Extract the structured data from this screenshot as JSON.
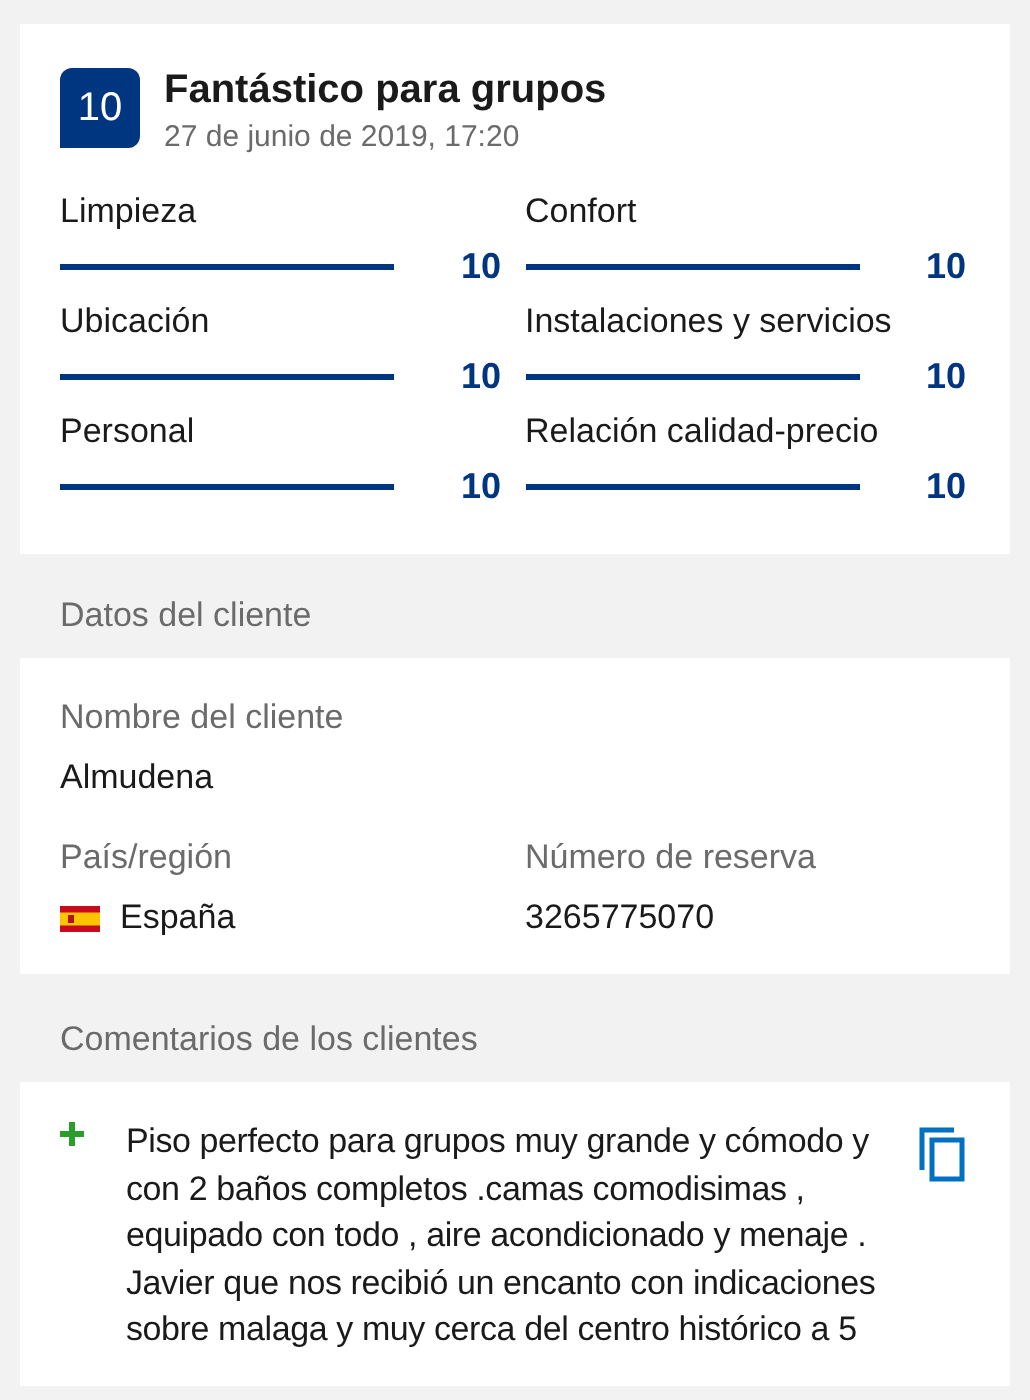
{
  "review": {
    "score": "10",
    "title": "Fantástico para grupos",
    "date": "27 de junio de 2019, 17:20",
    "categories": [
      {
        "label": "Limpieza",
        "score": "10",
        "level": 1
      },
      {
        "label": "Confort",
        "score": "10",
        "level": 1
      },
      {
        "label": "Ubicación",
        "score": "10",
        "level": 1
      },
      {
        "label": "Instalaciones y servicios",
        "score": "10",
        "level": 1
      },
      {
        "label": "Personal",
        "score": "10",
        "level": 1
      },
      {
        "label": "Relación calidad-precio",
        "score": "10",
        "level": 1
      }
    ]
  },
  "customer": {
    "heading": "Datos del cliente",
    "fields": [
      {
        "label": "Nombre del cliente",
        "value": "Almudena"
      },
      {
        "label": "País/región",
        "value": "España",
        "kind": "country"
      },
      {
        "label": "Número de reserva",
        "value": "3265775070"
      }
    ]
  },
  "comments": {
    "heading": "Comentarios de los clientes",
    "items": [
      {
        "kind": "positive",
        "text": "Piso perfecto para grupos muy grande y cómodo y con 2 baños completos .camas comodisimas , equipado con todo , aire acondicionado y menaje . Javier que nos recibió un encanto con indicaciones sobre malaga y muy cerca del centro histórico a 5"
      }
    ]
  }
}
